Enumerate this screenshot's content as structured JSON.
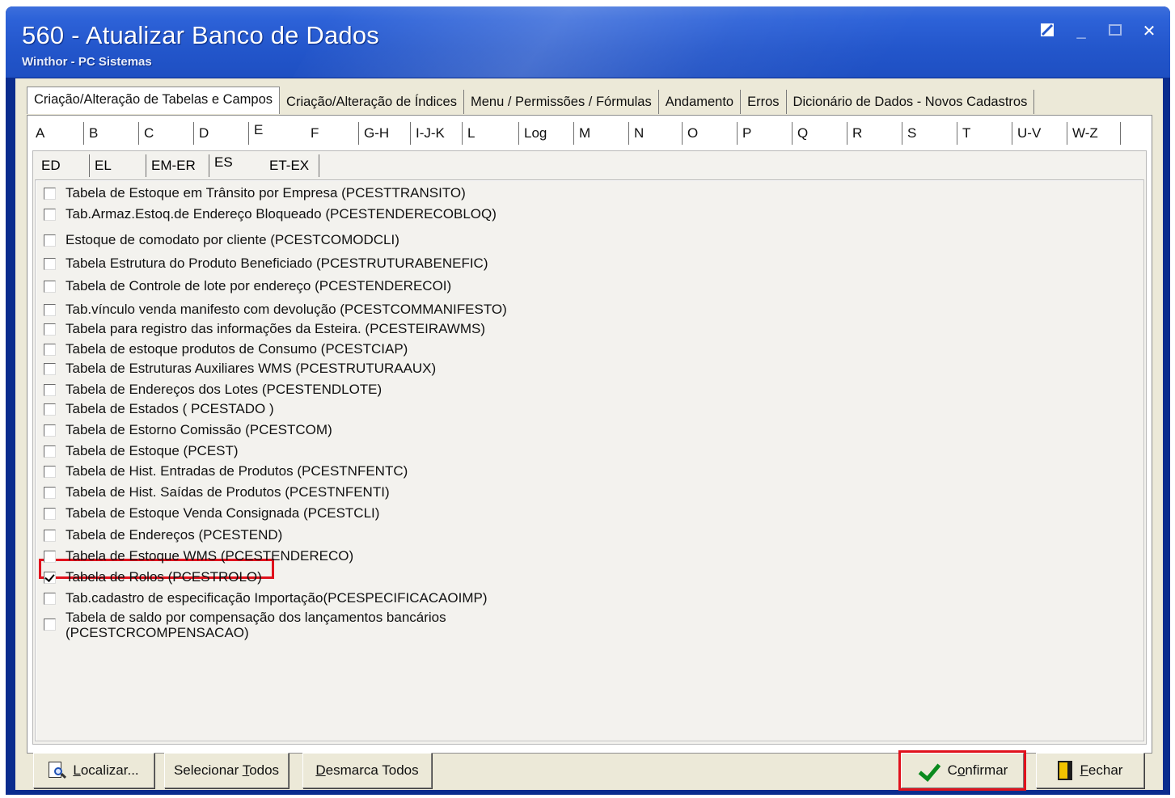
{
  "window": {
    "title": "560 - Atualizar Banco de Dados",
    "subtitle": "Winthor - PC Sistemas",
    "controls": [
      "help-icon",
      "minimize-icon",
      "maximize-icon",
      "close-icon"
    ],
    "minimize": "_",
    "close": "✕"
  },
  "tabs": [
    {
      "label": "Criação/Alteração de Tabelas e Campos",
      "active": true
    },
    {
      "label": "Criação/Alteração de Índices"
    },
    {
      "label": "Menu / Permissões / Fórmulas"
    },
    {
      "label": "Andamento"
    },
    {
      "label": "Erros"
    },
    {
      "label": "Dicionário de Dados - Novos Cadastros"
    }
  ],
  "letters": [
    "A",
    "B",
    "C",
    "D",
    "E",
    "F",
    "G-H",
    "I-J-K",
    "L",
    "Log",
    "M",
    "N",
    "O",
    "P",
    "Q",
    "R",
    "S",
    "T",
    "U-V",
    "W-Z"
  ],
  "active_letter": "E",
  "subtabs": [
    "ED",
    "EL",
    "EM-ER",
    "ES",
    "ET-EX"
  ],
  "active_subtab": "ES",
  "items": [
    {
      "label": "Tabela de Estoque em Trânsito por Empresa (PCESTTRANSITO)",
      "checked": false
    },
    {
      "label": "Tab.Armaz.Estoq.de Endereço Bloqueado (PCESTENDERECOBLOQ)",
      "checked": false
    },
    {
      "label": "Estoque de comodato por cliente (PCESTCOMODCLI)",
      "checked": false
    },
    {
      "label": "Tabela Estrutura do Produto Beneficiado (PCESTRUTURABENEFIC)",
      "checked": false
    },
    {
      "label": "Tabela de Controle de lote por endereço (PCESTENDERECOI)",
      "checked": false
    },
    {
      "label": "Tab.vínculo venda manifesto com devolução (PCESTCOMMANIFESTO)",
      "checked": false
    },
    {
      "label": "Tabela para registro das informações da Esteira. (PCESTEIRAWMS)",
      "checked": false
    },
    {
      "label": "Tabela de estoque produtos de Consumo (PCESTCIAP)",
      "checked": false
    },
    {
      "label": "Tabela de Estruturas Auxiliares WMS (PCESTRUTURAAUX)",
      "checked": false
    },
    {
      "label": "Tabela de Endereços dos Lotes (PCESTENDLOTE)",
      "checked": false
    },
    {
      "label": "Tabela de Estados ( PCESTADO )",
      "checked": false
    },
    {
      "label": "Tabela de Estorno Comissão (PCESTCOM)",
      "checked": false
    },
    {
      "label": "Tabela de Estoque (PCEST)",
      "checked": false
    },
    {
      "label": "Tabela de Hist. Entradas de Produtos (PCESTNFENTC)",
      "checked": false
    },
    {
      "label": "Tabela de Hist. Saídas de Produtos (PCESTNFENTI)",
      "checked": false
    },
    {
      "label": "Tabela de Estoque Venda Consignada (PCESTCLI)",
      "checked": false
    },
    {
      "label": "Tabela de Endereços (PCESTEND)",
      "checked": false
    },
    {
      "label": "Tabela de Estoque WMS (PCESTENDERECO)",
      "checked": false
    },
    {
      "label": "Tabela de Rolos (PCESTROLO)",
      "checked": true
    },
    {
      "label": "Tab.cadastro de especificação Importação(PCESPECIFICACAOIMP)",
      "checked": false
    },
    {
      "label": "Tabela de saldo por compensação dos lançamentos bancários",
      "label2": "(PCESTCRCOMPENSACAO)",
      "checked": false
    }
  ],
  "buttons": {
    "localizar": {
      "u": "L",
      "rest": "ocalizar..."
    },
    "selecionar": {
      "pre": "Selecionar ",
      "u": "T",
      "rest": "odos"
    },
    "desmarca": {
      "u": "D",
      "rest": "esmarca Todos"
    },
    "confirmar": {
      "pre": "C",
      "u": "o",
      "rest": "nfirmar"
    },
    "fechar": {
      "u": "F",
      "rest": "echar"
    }
  },
  "colors": {
    "highlight": "#e0121d",
    "titlebar": "#2356cb",
    "panel": "#ece9d8"
  }
}
